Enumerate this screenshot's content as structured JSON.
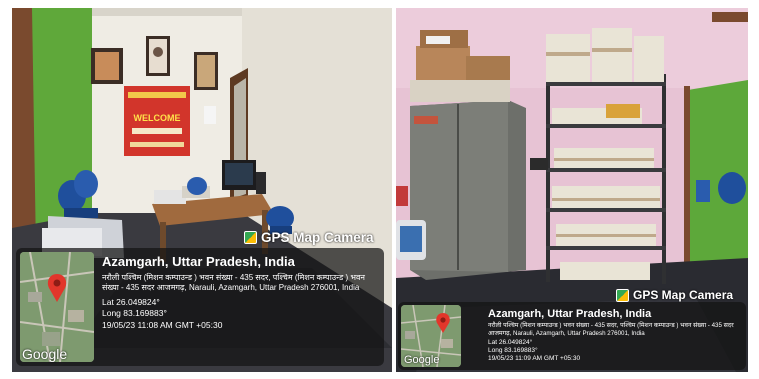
{
  "photos": [
    {
      "gps_label": "GPS Map Camera",
      "location_title": "Azamgarh, Uttar Pradesh, India",
      "address": "नरौली पश्चिम (मिशन कम्पाउन्ड ) भवन संख्या - 435 सदर, पश्चिम (मिशन कम्पाउन्ड ) भवन संख्या - 435 सदर आजमगढ़, Narauli, Azamgarh, Uttar Pradesh 276001, India",
      "lat": "Lat 26.049824°",
      "long": "Long 83.169883°",
      "timestamp": "19/05/23 11:08 AM GMT +05:30",
      "google": "Google",
      "banner_text": "WELCOME"
    },
    {
      "gps_label": "GPS Map Camera",
      "location_title": "Azamgarh, Uttar Pradesh, India",
      "address": "नरौली पश्चिम (मिशन कम्पाउन्ड ) भवन संख्या - 435 सदर, पश्चिम (मिशन कम्पाउन्ड ) भवन संख्या - 435 सदर आजमगढ़, Narauli, Azamgarh, Uttar Pradesh 276001, India",
      "lat": "Lat 26.049824°",
      "long": "Long 83.169883°",
      "timestamp": "19/05/23 11:09 AM GMT +05:30",
      "google": "Google"
    }
  ],
  "colors": {
    "wall_green": "#5fa83a",
    "wall_white": "#ece8df",
    "wall_pink": "#e9c5d6",
    "door_brown": "#7a4a2e",
    "chair_blue": "#1f4f9c",
    "banner_red": "#d2352b",
    "cabinet_gray": "#6d6f6a",
    "map_pin": "#e2362b"
  }
}
